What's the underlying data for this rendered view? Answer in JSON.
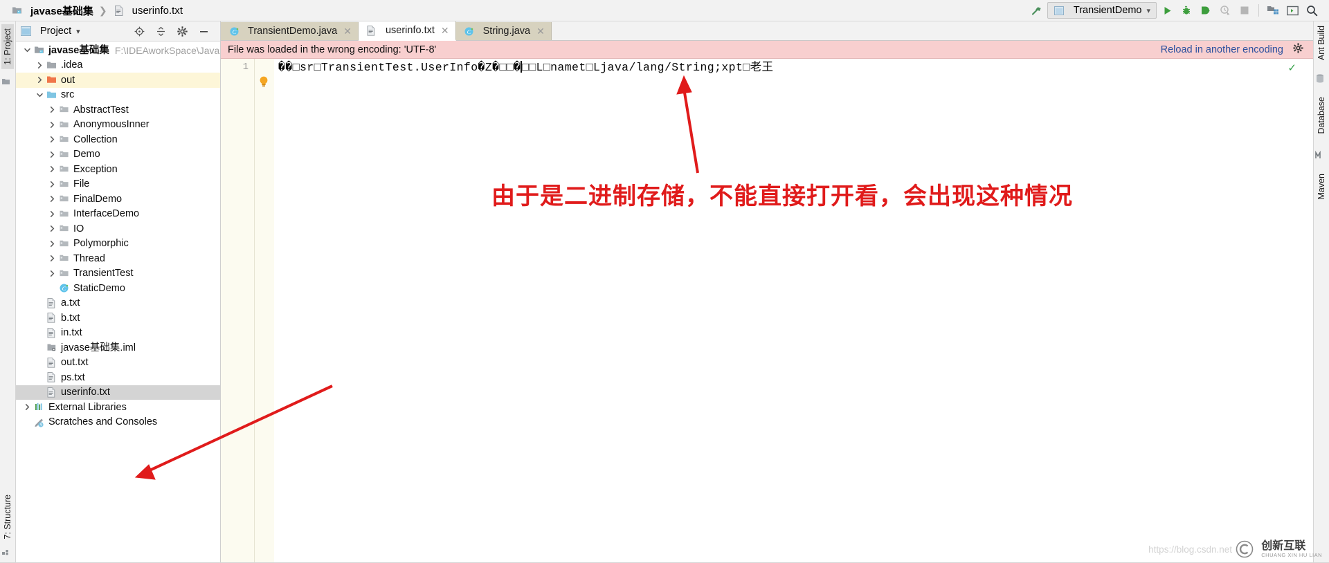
{
  "breadcrumb": {
    "project": "javase基础集",
    "file": "userinfo.txt"
  },
  "toolbar": {
    "build_icon": "hammer-icon",
    "run_config": "TransientDemo",
    "chevron": "▾",
    "run_icon": "run-icon",
    "debug_icon": "debug-icon",
    "run_coverage_icon": "run-with-coverage-icon",
    "profile_icon": "profile-icon",
    "stop_icon": "stop-icon",
    "project_structure_icon": "project-structure-icon",
    "terminal_icon": "terminal-icon",
    "search_icon": "search-everywhere-icon"
  },
  "left_strip": {
    "project_label": "1: Project",
    "structure_label": "7: Structure",
    "favorites_icon": "favorites-icon",
    "bottom_icon": "more-tool-windows-icon"
  },
  "right_strip": {
    "items": [
      {
        "label": "Ant Build",
        "icon": "ant-icon"
      },
      {
        "label": "Database",
        "icon": "database-icon"
      },
      {
        "label": "Maven",
        "icon": "maven-icon"
      }
    ]
  },
  "project_panel": {
    "title": "Project",
    "dropdown_arrow": "▾",
    "actions": [
      {
        "name": "locate-icon",
        "glyph": "⊕"
      },
      {
        "name": "collapse-all-icon",
        "glyph": "≐"
      },
      {
        "name": "settings-gear-icon",
        "glyph": "✿"
      },
      {
        "name": "hide-icon",
        "glyph": "—"
      }
    ],
    "tree": [
      {
        "depth": 0,
        "arrow": "down",
        "icon": "project-folder",
        "label": "javase基础集",
        "path": "F:\\IDEAworkSpace\\JavaSE重点",
        "bold": true,
        "highlight": "none"
      },
      {
        "depth": 1,
        "arrow": "right",
        "icon": "folder-grey",
        "label": ".idea",
        "highlight": "none"
      },
      {
        "depth": 1,
        "arrow": "right",
        "icon": "folder-orange",
        "label": "out",
        "highlight": "yellow"
      },
      {
        "depth": 1,
        "arrow": "down",
        "icon": "folder-blue",
        "label": "src",
        "highlight": "none"
      },
      {
        "depth": 2,
        "arrow": "right",
        "icon": "folder-package",
        "label": "AbstractTest",
        "highlight": "none"
      },
      {
        "depth": 2,
        "arrow": "right",
        "icon": "folder-package",
        "label": "AnonymousInner",
        "highlight": "none"
      },
      {
        "depth": 2,
        "arrow": "right",
        "icon": "folder-package",
        "label": "Collection",
        "highlight": "none"
      },
      {
        "depth": 2,
        "arrow": "right",
        "icon": "folder-package",
        "label": "Demo",
        "highlight": "none"
      },
      {
        "depth": 2,
        "arrow": "right",
        "icon": "folder-package",
        "label": "Exception",
        "highlight": "none"
      },
      {
        "depth": 2,
        "arrow": "right",
        "icon": "folder-package",
        "label": "File",
        "highlight": "none"
      },
      {
        "depth": 2,
        "arrow": "right",
        "icon": "folder-package",
        "label": "FinalDemo",
        "highlight": "none"
      },
      {
        "depth": 2,
        "arrow": "right",
        "icon": "folder-package",
        "label": "InterfaceDemo",
        "highlight": "none"
      },
      {
        "depth": 2,
        "arrow": "right",
        "icon": "folder-package",
        "label": "IO",
        "highlight": "none"
      },
      {
        "depth": 2,
        "arrow": "right",
        "icon": "folder-package",
        "label": "Polymorphic",
        "highlight": "none"
      },
      {
        "depth": 2,
        "arrow": "right",
        "icon": "folder-package",
        "label": "Thread",
        "highlight": "none"
      },
      {
        "depth": 2,
        "arrow": "right",
        "icon": "folder-package",
        "label": "TransientTest",
        "highlight": "none"
      },
      {
        "depth": 2,
        "arrow": "none",
        "icon": "java-class",
        "label": "StaticDemo",
        "highlight": "none"
      },
      {
        "depth": 1,
        "arrow": "none",
        "icon": "text-file",
        "label": "a.txt",
        "highlight": "none"
      },
      {
        "depth": 1,
        "arrow": "none",
        "icon": "text-file",
        "label": "b.txt",
        "highlight": "none"
      },
      {
        "depth": 1,
        "arrow": "none",
        "icon": "text-file",
        "label": "in.txt",
        "highlight": "none"
      },
      {
        "depth": 1,
        "arrow": "none",
        "icon": "iml-file",
        "label": "javase基础集.iml",
        "highlight": "none"
      },
      {
        "depth": 1,
        "arrow": "none",
        "icon": "text-file",
        "label": "out.txt",
        "highlight": "none"
      },
      {
        "depth": 1,
        "arrow": "none",
        "icon": "text-file",
        "label": "ps.txt",
        "highlight": "none"
      },
      {
        "depth": 1,
        "arrow": "none",
        "icon": "text-file",
        "label": "userinfo.txt",
        "highlight": "grey"
      },
      {
        "depth": 0,
        "arrow": "right",
        "icon": "libraries",
        "label": "External Libraries",
        "highlight": "none"
      },
      {
        "depth": 0,
        "arrow": "none",
        "icon": "scratches",
        "label": "Scratches and Consoles",
        "highlight": "none"
      }
    ]
  },
  "editor": {
    "tabs": [
      {
        "label": "TransientDemo.java",
        "icon": "java-class",
        "active": false,
        "close": "✕"
      },
      {
        "label": "userinfo.txt",
        "icon": "text-file",
        "active": true,
        "close": "✕"
      },
      {
        "label": "String.java",
        "icon": "java-class",
        "active": false,
        "close": "✕"
      }
    ],
    "banner": {
      "message": "File was loaded in the wrong encoding: 'UTF-8'",
      "link": "Reload in another encoding",
      "gear_icon": "gear-icon"
    },
    "line_number": "1",
    "content_part1": "��□sr□TransientTest.UserInfo�Z�□□�",
    "content_part2": "□□L□namet□Ljava/lang/String;xpt□老王",
    "inspection_ok_icon": "✓",
    "bulb_icon": "intention-bulb-icon"
  },
  "annotations": {
    "note_text": "由于是二进制存储，不能直接打开看，会出现这种情况",
    "note_color": "#e01b1b"
  },
  "watermark": {
    "url": "https://blog.csdn.net",
    "brand": "创新互联",
    "brand_sub": "CHUANG XIN HU LIAN"
  },
  "colors": {
    "accent_green": "#3d9e3d",
    "banner_bg": "#f8cfcf",
    "link_blue": "#2b4f9e",
    "selection_grey": "#d4d4d4",
    "highlight_yellow": "#fdf6d8"
  }
}
